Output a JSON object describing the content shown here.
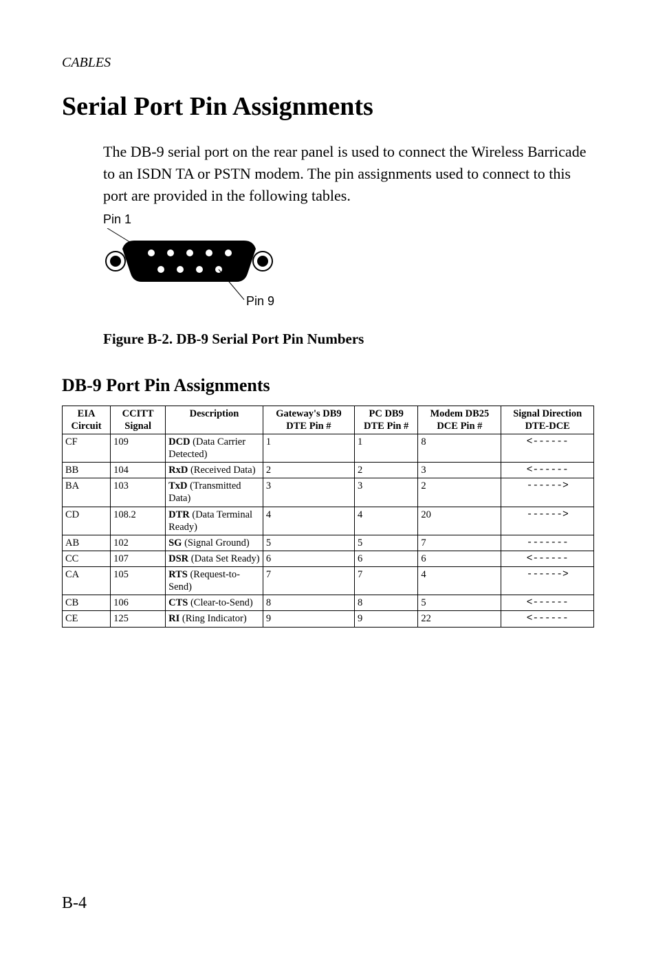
{
  "running_head": "CABLES",
  "title": "Serial Port Pin Assignments",
  "intro": "The DB-9 serial port on the rear panel is used to connect the Wireless Barricade to an ISDN TA or PSTN modem. The pin assignments used to connect to this port are provided in the following tables.",
  "figure": {
    "pin1_label": "Pin 1",
    "pin9_label": "Pin 9",
    "caption": "Figure B-2.  DB-9 Serial Port Pin Numbers"
  },
  "subhead": "DB-9 Port Pin Assignments",
  "table": {
    "headers": {
      "eia": "EIA Circuit",
      "ccitt": "CCITT Signal",
      "desc": "Description",
      "gwpin": "Gateway's DB9 DTE Pin #",
      "dtepin": "PC DB9 DTE Pin #",
      "dcepin": "Modem DB25 DCE Pin #",
      "dir": "Signal Direction DTE-DCE"
    },
    "rows": [
      {
        "eia": "CF",
        "ccitt": "109",
        "abbr": "DCD",
        "desc_rest": " (Data Carrier Detected)",
        "gwpin": "1",
        "dtepin": "1",
        "dcepin": "8",
        "dir": "<------"
      },
      {
        "eia": "BB",
        "ccitt": "104",
        "abbr": "RxD",
        "desc_rest": " (Received Data)",
        "gwpin": "2",
        "dtepin": "2",
        "dcepin": "3",
        "dir": "<------"
      },
      {
        "eia": "BA",
        "ccitt": "103",
        "abbr": "TxD",
        "desc_rest": " (Transmitted Data)",
        "gwpin": "3",
        "dtepin": "3",
        "dcepin": "2",
        "dir": "------>"
      },
      {
        "eia": "CD",
        "ccitt": "108.2",
        "abbr": "DTR",
        "desc_rest": " (Data Terminal Ready)",
        "gwpin": "4",
        "dtepin": "4",
        "dcepin": "20",
        "dir": "------>"
      },
      {
        "eia": "AB",
        "ccitt": "102",
        "abbr": "SG",
        "desc_rest": " (Signal Ground)",
        "gwpin": "5",
        "dtepin": "5",
        "dcepin": "7",
        "dir": "-------"
      },
      {
        "eia": "CC",
        "ccitt": "107",
        "abbr": "DSR",
        "desc_rest": " (Data Set Ready)",
        "gwpin": "6",
        "dtepin": "6",
        "dcepin": "6",
        "dir": "<------"
      },
      {
        "eia": "CA",
        "ccitt": "105",
        "abbr": "RTS",
        "desc_rest": " (Request-to-Send)",
        "gwpin": "7",
        "dtepin": "7",
        "dcepin": "4",
        "dir": "------>"
      },
      {
        "eia": "CB",
        "ccitt": "106",
        "abbr": "CTS",
        "desc_rest": " (Clear-to-Send)",
        "gwpin": "8",
        "dtepin": "8",
        "dcepin": "5",
        "dir": "<------"
      },
      {
        "eia": "CE",
        "ccitt": "125",
        "abbr": "RI",
        "desc_rest": " (Ring Indicator)",
        "gwpin": "9",
        "dtepin": "9",
        "dcepin": "22",
        "dir": "<------"
      }
    ]
  },
  "page_number": "B-4"
}
